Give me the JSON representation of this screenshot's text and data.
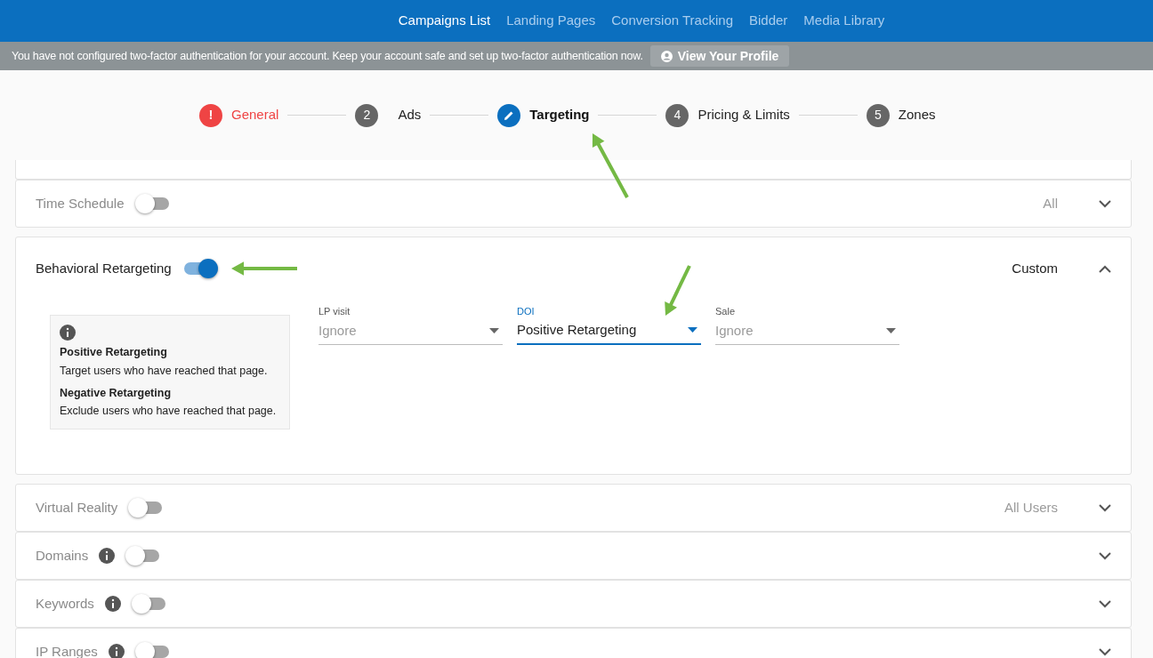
{
  "nav": [
    {
      "label": "Campaigns List",
      "selected": true
    },
    {
      "label": "Landing Pages",
      "selected": false
    },
    {
      "label": "Conversion Tracking",
      "selected": false
    },
    {
      "label": "Bidder",
      "selected": false
    },
    {
      "label": "Media Library",
      "selected": false
    }
  ],
  "banner": {
    "message": "You have not configured two-factor authentication for your account. Keep your account safe and set up two-factor authentication now.",
    "button": "View Your Profile"
  },
  "steps": [
    {
      "kind": "error",
      "mark": "!",
      "label": "General"
    },
    {
      "kind": "number",
      "mark": "2",
      "label": "Ads"
    },
    {
      "kind": "current",
      "label": "Targeting"
    },
    {
      "kind": "number",
      "mark": "4",
      "label": "Pricing & Limits"
    },
    {
      "kind": "number",
      "mark": "5",
      "label": "Zones"
    }
  ],
  "sections": [
    {
      "label": "Time Schedule",
      "info": false,
      "on": false,
      "expanded": false,
      "summary": "All"
    },
    {
      "label": "Behavioral Retargeting",
      "info": false,
      "on": true,
      "expanded": true,
      "summary": "Custom",
      "help": [
        {
          "title": "Positive Retargeting",
          "text": "Target users who have reached that page."
        },
        {
          "title": "Negative Retargeting",
          "text": "Exclude users who have reached that page."
        }
      ],
      "selects": [
        {
          "label": "LP visit",
          "value": "Ignore",
          "focused": false,
          "placeholder_style": true
        },
        {
          "label": "DOI",
          "value": "Positive Retargeting",
          "focused": true,
          "placeholder_style": false
        },
        {
          "label": "Sale",
          "value": "Ignore",
          "focused": false,
          "placeholder_style": true
        }
      ]
    },
    {
      "label": "Virtual Reality",
      "info": false,
      "on": false,
      "expanded": false,
      "summary": "All Users"
    },
    {
      "label": "Domains",
      "info": true,
      "on": false,
      "expanded": false
    },
    {
      "label": "Keywords",
      "info": true,
      "on": false,
      "expanded": false
    },
    {
      "label": "IP Ranges",
      "info": true,
      "on": false,
      "expanded": false
    }
  ]
}
